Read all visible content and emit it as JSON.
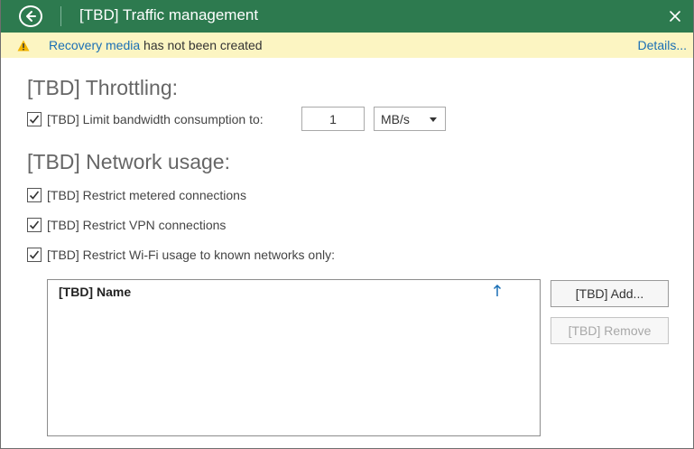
{
  "window": {
    "title": "[TBD] Traffic management"
  },
  "notice": {
    "link_text": "Recovery media",
    "message": " has not been created",
    "details_link": "Details..."
  },
  "throttling": {
    "title": "[TBD] Throttling:",
    "limit_label": "[TBD] Limit bandwidth consumption to:",
    "limit_checked": true,
    "limit_value": "1",
    "unit": "MB/s"
  },
  "network": {
    "title": "[TBD] Network usage:",
    "options": [
      {
        "label": "[TBD] Restrict metered connections",
        "checked": true
      },
      {
        "label": "[TBD] Restrict VPN connections",
        "checked": true
      },
      {
        "label": "[TBD] Restrict Wi-Fi usage to known networks only:",
        "checked": true
      }
    ]
  },
  "networks_list": {
    "column_header": "[TBD] Name",
    "sort_icon": "arrow-up-icon"
  },
  "buttons": {
    "add": "[TBD] Add...",
    "remove": "[TBD] Remove"
  },
  "colors": {
    "titlebar": "#2d7a4f",
    "notice_bg": "#fcf5c2",
    "link": "#1a6fb5",
    "warning": "#f2b400"
  }
}
